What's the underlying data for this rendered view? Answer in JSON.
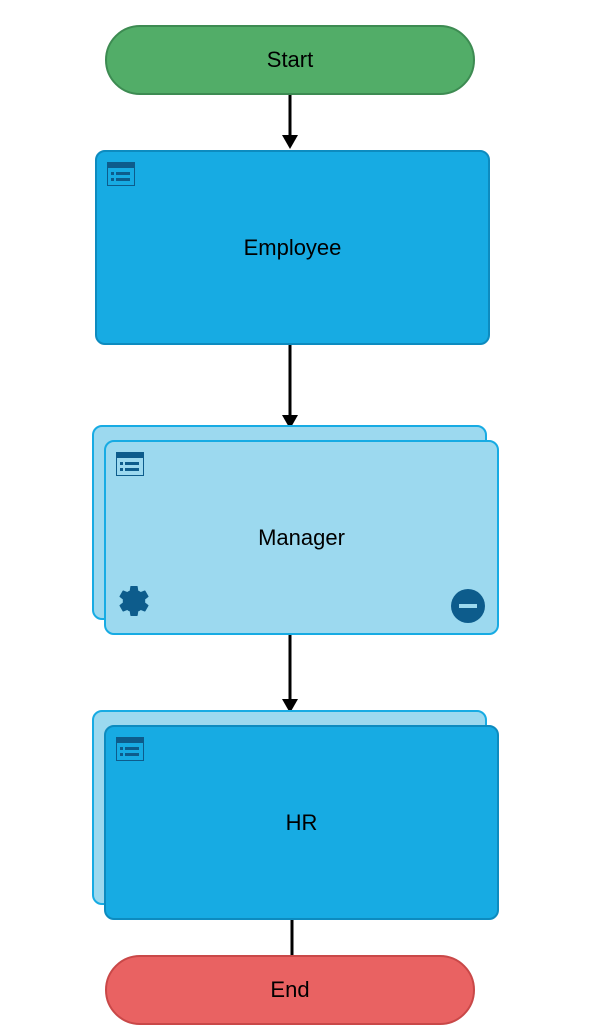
{
  "flowchart": {
    "nodes": {
      "start": {
        "label": "Start",
        "type": "terminal-start"
      },
      "employee": {
        "label": "Employee",
        "type": "task",
        "form_icon": true
      },
      "manager": {
        "label": "Manager",
        "type": "multi-task-light",
        "form_icon": true,
        "gear_icon": true,
        "minus_badge": true
      },
      "hr": {
        "label": "HR",
        "type": "multi-task",
        "form_icon": true
      },
      "end": {
        "label": "End",
        "type": "terminal-end"
      }
    },
    "edges": [
      {
        "from": "start",
        "to": "employee"
      },
      {
        "from": "employee",
        "to": "manager"
      },
      {
        "from": "manager",
        "to": "hr"
      },
      {
        "from": "hr",
        "to": "end"
      }
    ],
    "colors": {
      "start_fill": "#52ad68",
      "end_fill": "#e96262",
      "task_fill": "#17abe3",
      "task_light_fill": "#9cd9ef",
      "icon_color": "#0d5c8c"
    }
  }
}
